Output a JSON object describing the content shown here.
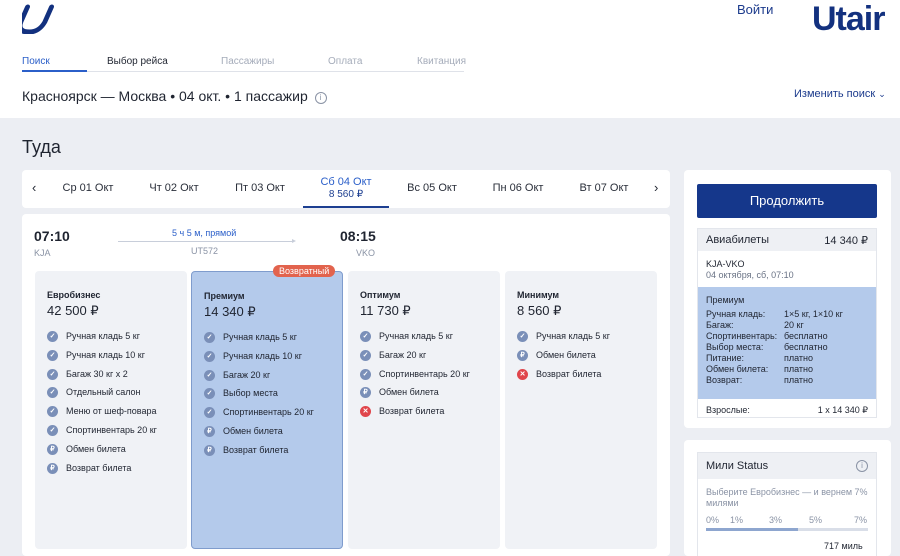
{
  "header": {
    "brand": "Utair",
    "signin": "Войти",
    "steps": [
      {
        "label": "Поиск",
        "state": "done"
      },
      {
        "label": "Выбор рейса",
        "state": "current"
      },
      {
        "label": "Пассажиры",
        "state": "todo"
      },
      {
        "label": "Оплата",
        "state": "todo"
      },
      {
        "label": "Квитанция",
        "state": "todo"
      }
    ],
    "route_summary": "Красноярск — Москва • 04 окт. • 1 пассажир",
    "change_search": "Изменить поиск"
  },
  "direction_title": "Туда",
  "dates": [
    {
      "label": "Ср 01 Окт",
      "price": ""
    },
    {
      "label": "Чт 02 Окт",
      "price": ""
    },
    {
      "label": "Пт 03 Окт",
      "price": ""
    },
    {
      "label": "Сб 04 Окт",
      "price": "8 560 ₽",
      "selected": true
    },
    {
      "label": "Вс 05 Окт",
      "price": ""
    },
    {
      "label": "Пн 06 Окт",
      "price": ""
    },
    {
      "label": "Вт 07 Окт",
      "price": ""
    }
  ],
  "flight": {
    "depart_time": "07:10",
    "depart_code": "KJA",
    "arrive_time": "08:15",
    "arrive_code": "VKO",
    "duration": "5 ч 5 м, прямой",
    "flight_no": "UT572"
  },
  "fares": [
    {
      "name": "Евробизнес",
      "price": "42 500 ₽",
      "selected": false,
      "features": [
        {
          "text": "Ручная кладь 5 кг",
          "type": "ok"
        },
        {
          "text": "Ручная кладь 10 кг",
          "type": "ok"
        },
        {
          "text": "Багаж 30 кг x 2",
          "type": "ok"
        },
        {
          "text": "Отдельный салон",
          "type": "ok"
        },
        {
          "text": "Меню от шеф-повара",
          "type": "ok"
        },
        {
          "text": "Спортинвентарь 20 кг",
          "type": "ok"
        },
        {
          "text": "Обмен билета",
          "type": "pay"
        },
        {
          "text": "Возврат билета",
          "type": "pay"
        }
      ]
    },
    {
      "name": "Премиум",
      "price": "14 340 ₽",
      "selected": true,
      "badge": "Возвратный",
      "features": [
        {
          "text": "Ручная кладь 5 кг",
          "type": "ok"
        },
        {
          "text": "Ручная кладь 10 кг",
          "type": "ok"
        },
        {
          "text": "Багаж 20 кг",
          "type": "ok"
        },
        {
          "text": "Выбор места",
          "type": "ok"
        },
        {
          "text": "Спортинвентарь 20 кг",
          "type": "ok"
        },
        {
          "text": "Обмен билета",
          "type": "pay"
        },
        {
          "text": "Возврат билета",
          "type": "pay"
        }
      ]
    },
    {
      "name": "Оптимум",
      "price": "11 730 ₽",
      "selected": false,
      "features": [
        {
          "text": "Ручная кладь 5 кг",
          "type": "ok"
        },
        {
          "text": "Багаж 20 кг",
          "type": "ok"
        },
        {
          "text": "Спортинвентарь 20 кг",
          "type": "ok"
        },
        {
          "text": "Обмен билета",
          "type": "pay"
        },
        {
          "text": "Возврат билета",
          "type": "no"
        }
      ]
    },
    {
      "name": "Минимум",
      "price": "8 560 ₽",
      "selected": false,
      "features": [
        {
          "text": "Ручная кладь 5 кг",
          "type": "ok"
        },
        {
          "text": "Обмен билета",
          "type": "pay"
        },
        {
          "text": "Возврат билета",
          "type": "no"
        }
      ]
    }
  ],
  "summary": {
    "continue_label": "Продолжить",
    "tickets_label": "Авиабилеты",
    "tickets_total": "14 340 ₽",
    "route": "KJA-VKO",
    "date": "04 октября, сб, 07:10",
    "fare_name": "Премиум",
    "rows": [
      {
        "k": "Ручная кладь:",
        "v": "1×5 кг, 1×10 кг"
      },
      {
        "k": "Багаж:",
        "v": "20 кг"
      },
      {
        "k": "Спортинвентарь:",
        "v": "бесплатно"
      },
      {
        "k": "Выбор места:",
        "v": "бесплатно"
      },
      {
        "k": "Питание:",
        "v": "платно"
      },
      {
        "k": "Обмен билета:",
        "v": "платно"
      },
      {
        "k": "Возврат:",
        "v": "платно"
      }
    ],
    "adults_label": "Взрослые:",
    "adults_value": "1 x 14 340 ₽"
  },
  "miles": {
    "title": "Мили Status",
    "description": "Выберите Евробизнес — и вернем 7% милями",
    "percents": [
      "0%",
      "1%",
      "3%",
      "5%",
      "7%"
    ],
    "progress": 0.57,
    "value": "717 миль"
  },
  "colors": {
    "brand": "#13317f",
    "accent": "#2b5fc9",
    "selected_fare": "#b4caeb",
    "badge": "#e2634d"
  },
  "icons": {
    "ok": "check-circle-icon",
    "pay": "ruble-circle-icon",
    "no": "cross-circle-icon"
  }
}
